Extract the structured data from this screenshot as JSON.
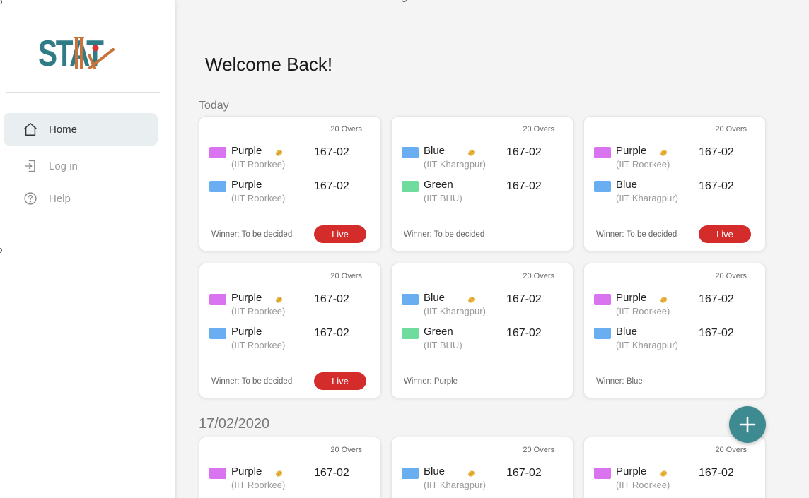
{
  "brand": {
    "name": "STAT",
    "colors": {
      "primary": "#2f7b86",
      "accent": "#c8733a",
      "dot": "#d93535"
    }
  },
  "sidebar": {
    "items": [
      {
        "label": "Home",
        "icon": "home-icon",
        "active": true
      },
      {
        "label": "Log in",
        "icon": "login-icon",
        "active": false
      },
      {
        "label": "Help",
        "icon": "help-icon",
        "active": false
      }
    ]
  },
  "main": {
    "welcome": "Welcome Back!",
    "sections": [
      {
        "label": "Today",
        "matches": [
          {
            "overs": "20 Overs",
            "teams": [
              {
                "name": "Purple",
                "institute": "(IIT Roorkee)",
                "score": "167-02",
                "color": "#d973f0",
                "batting": true
              },
              {
                "name": "Purple",
                "institute": "(IIT Roorkee)",
                "score": "167-02",
                "color": "#6aaef2",
                "batting": false
              }
            ],
            "winner": "Winner: To be decided",
            "live": "Live"
          },
          {
            "overs": "20 Overs",
            "teams": [
              {
                "name": "Blue",
                "institute": "(IIT Kharagpur)",
                "score": "167-02",
                "color": "#6aaef2",
                "batting": true
              },
              {
                "name": "Green",
                "institute": "(IIT BHU)",
                "score": "167-02",
                "color": "#6fdb9c",
                "batting": false
              }
            ],
            "winner": "Winner: To be decided",
            "live": ""
          },
          {
            "overs": "20 Overs",
            "teams": [
              {
                "name": "Purple",
                "institute": "(IIT Roorkee)",
                "score": "167-02",
                "color": "#d973f0",
                "batting": true
              },
              {
                "name": "Blue",
                "institute": "(IIT Kharagpur)",
                "score": "167-02",
                "color": "#6aaef2",
                "batting": false
              }
            ],
            "winner": "Winner: To be decided",
            "live": "Live"
          },
          {
            "overs": "20 Overs",
            "teams": [
              {
                "name": "Purple",
                "institute": "(IIT Roorkee)",
                "score": "167-02",
                "color": "#d973f0",
                "batting": true
              },
              {
                "name": "Purple",
                "institute": "(IIT Roorkee)",
                "score": "167-02",
                "color": "#6aaef2",
                "batting": false
              }
            ],
            "winner": "Winner: To be decided",
            "live": "Live"
          },
          {
            "overs": "20 Overs",
            "teams": [
              {
                "name": "Blue",
                "institute": "(IIT Kharagpur)",
                "score": "167-02",
                "color": "#6aaef2",
                "batting": true
              },
              {
                "name": "Green",
                "institute": "(IIT BHU)",
                "score": "167-02",
                "color": "#6fdb9c",
                "batting": false
              }
            ],
            "winner": "Winner: Purple",
            "live": ""
          },
          {
            "overs": "20 Overs",
            "teams": [
              {
                "name": "Purple",
                "institute": "(IIT Roorkee)",
                "score": "167-02",
                "color": "#d973f0",
                "batting": true
              },
              {
                "name": "Blue",
                "institute": "(IIT Kharagpur)",
                "score": "167-02",
                "color": "#6aaef2",
                "batting": false
              }
            ],
            "winner": "Winner: Blue",
            "live": ""
          }
        ]
      },
      {
        "label": "17/02/2020",
        "matches": [
          {
            "overs": "20 Overs",
            "teams": [
              {
                "name": "Purple",
                "institute": "(IIT Roorkee)",
                "score": "167-02",
                "color": "#d973f0",
                "batting": true
              }
            ],
            "winner": "",
            "live": ""
          },
          {
            "overs": "20 Overs",
            "teams": [
              {
                "name": "Blue",
                "institute": "(IIT Kharagpur)",
                "score": "167-02",
                "color": "#6aaef2",
                "batting": true
              }
            ],
            "winner": "",
            "live": ""
          },
          {
            "overs": "20 Overs",
            "teams": [
              {
                "name": "Purple",
                "institute": "(IIT Roorkee)",
                "score": "167-02",
                "color": "#d973f0",
                "batting": true
              }
            ],
            "winner": "",
            "live": ""
          }
        ]
      }
    ]
  },
  "fab": {
    "icon": "plus-icon"
  }
}
